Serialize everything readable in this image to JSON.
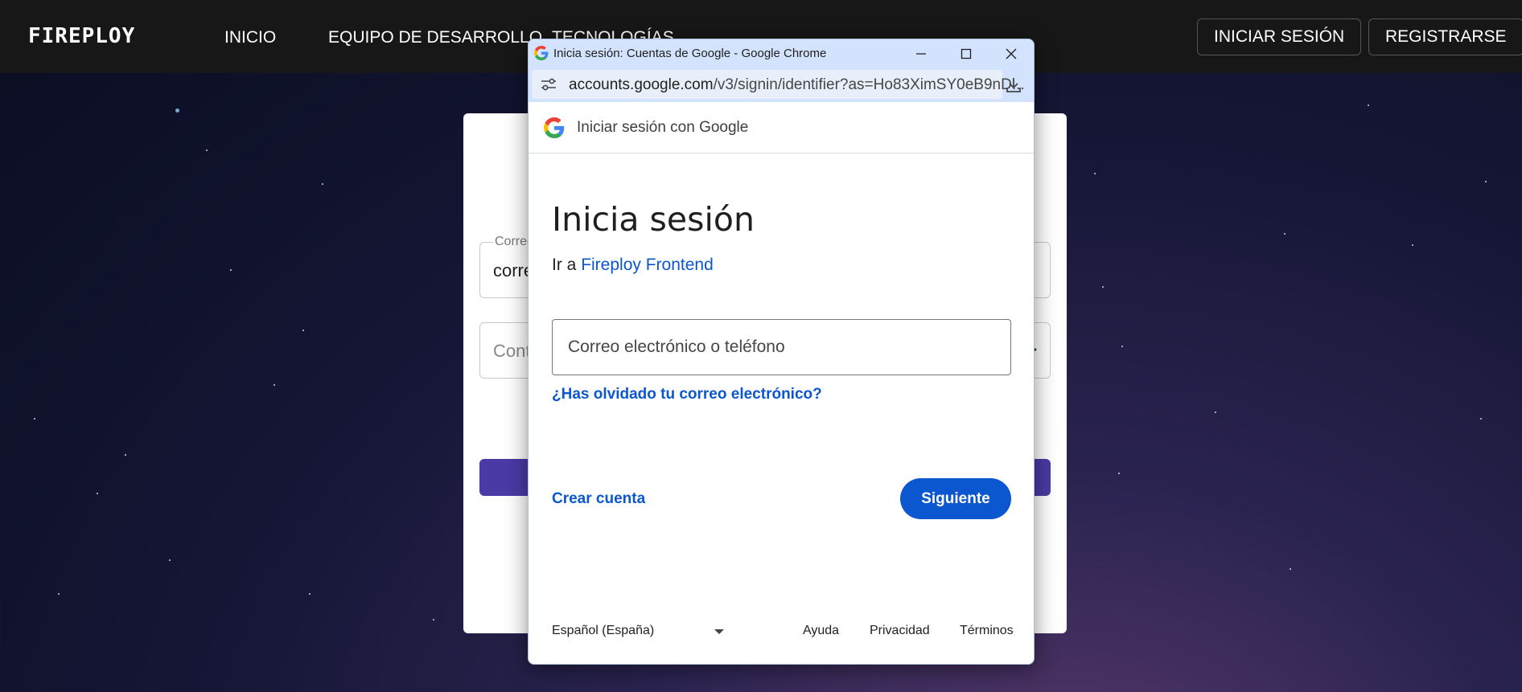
{
  "site": {
    "brand": "FIREPLOY",
    "nav": [
      {
        "label": "INICIO"
      },
      {
        "label": "EQUIPO DE DESARROLLO"
      },
      {
        "label": "TECNOLOGÍAS"
      }
    ],
    "login_button": "INICIAR SESIÓN",
    "register_button": "REGISTRARSE"
  },
  "background_form": {
    "email_label": "Correo",
    "email_value": "corre",
    "password_placeholder": "Cont"
  },
  "popup": {
    "window_title": "Inicia sesión: Cuentas de Google - Google Chrome",
    "url_host": "accounts.google.com",
    "url_path": "/v3/signin/identifier?as=Ho83XimSY0eB9nD...",
    "header_text": "Iniciar sesión con Google",
    "heading": "Inicia sesión",
    "subtitle_prefix": "Ir a ",
    "app_name": "Fireploy Frontend",
    "email_placeholder": "Correo electrónico o teléfono",
    "forgot_email": "¿Has olvidado tu correo electrónico?",
    "create_account": "Crear cuenta",
    "next_button": "Siguiente",
    "language": "Español (España)",
    "footer_links": {
      "help": "Ayuda",
      "privacy": "Privacidad",
      "terms": "Términos"
    }
  },
  "colors": {
    "google_blue": "#0b57d0",
    "navbar_bg": "#171717",
    "chrome_titlebar": "#d3e3fd",
    "submit_button": "#4a3aa6"
  }
}
